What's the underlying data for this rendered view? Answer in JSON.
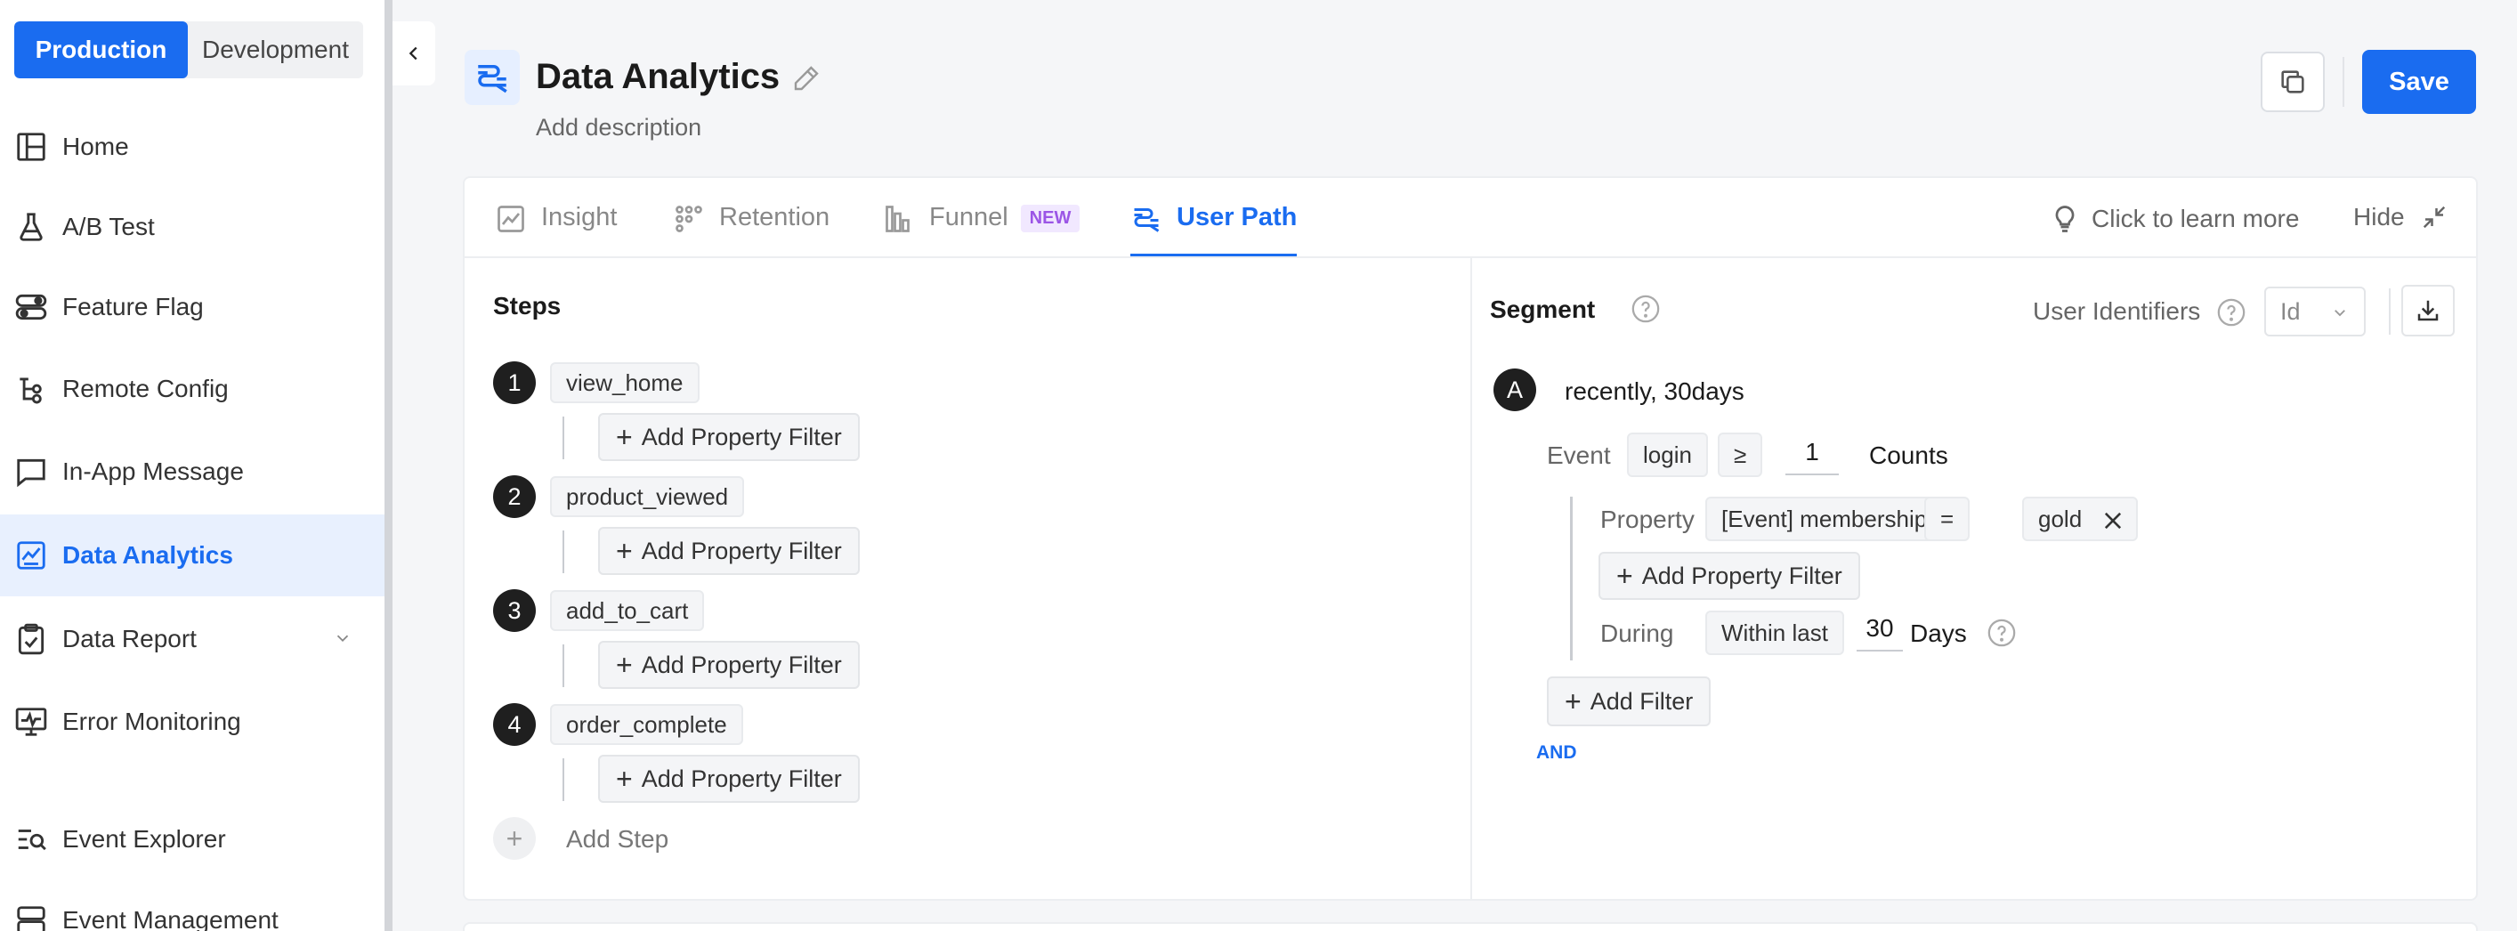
{
  "env": {
    "production": "Production",
    "development": "Development"
  },
  "nav": [
    {
      "label": "Home",
      "icon": "layout-icon"
    },
    {
      "label": "A/B Test",
      "icon": "flask-icon"
    },
    {
      "label": "Feature Flag",
      "icon": "toggle-icon"
    },
    {
      "label": "Remote Config",
      "icon": "config-icon"
    },
    {
      "label": "In-App Message",
      "icon": "message-icon"
    },
    {
      "label": "Data Analytics",
      "icon": "analytics-icon",
      "active": true
    },
    {
      "label": "Data Report",
      "icon": "report-icon"
    },
    {
      "label": "Error Monitoring",
      "icon": "monitor-icon"
    },
    {
      "label": "Event Explorer",
      "icon": "explorer-icon"
    },
    {
      "label": "Event Management",
      "icon": "server-icon"
    }
  ],
  "header": {
    "title": "Data Analytics",
    "description": "Add description",
    "save": "Save"
  },
  "tabs": [
    {
      "label": "Insight",
      "icon": "insight-icon"
    },
    {
      "label": "Retention",
      "icon": "retention-icon"
    },
    {
      "label": "Funnel",
      "icon": "funnel-icon",
      "badge": "NEW"
    },
    {
      "label": "User Path",
      "icon": "user-path-icon",
      "active": true
    }
  ],
  "toolbar": {
    "learn": "Click to learn more",
    "hide": "Hide"
  },
  "steps": {
    "title": "Steps",
    "items": [
      {
        "num": "1",
        "event": "view_home",
        "filter": "Add Property Filter"
      },
      {
        "num": "2",
        "event": "product_viewed",
        "filter": "Add Property Filter"
      },
      {
        "num": "3",
        "event": "add_to_cart",
        "filter": "Add Property Filter"
      },
      {
        "num": "4",
        "event": "order_complete",
        "filter": "Add Property Filter"
      }
    ],
    "add_step": "Add Step"
  },
  "segment": {
    "title": "Segment",
    "user_identifiers": "User Identifiers",
    "id_value": "Id",
    "letter": "A",
    "name": "recently, 30days",
    "event_label": "Event",
    "event_value": "login",
    "operator": "≥",
    "count": "1",
    "count_unit": "Counts",
    "property_label": "Property",
    "property_value": "[Event] membership",
    "property_op": "=",
    "property_val": "gold",
    "and": "AND",
    "add_property_filter": "Add Property Filter",
    "during_label": "During",
    "during_value": "Within last",
    "during_number": "30",
    "during_unit": "Days",
    "add_filter": "Add Filter"
  }
}
